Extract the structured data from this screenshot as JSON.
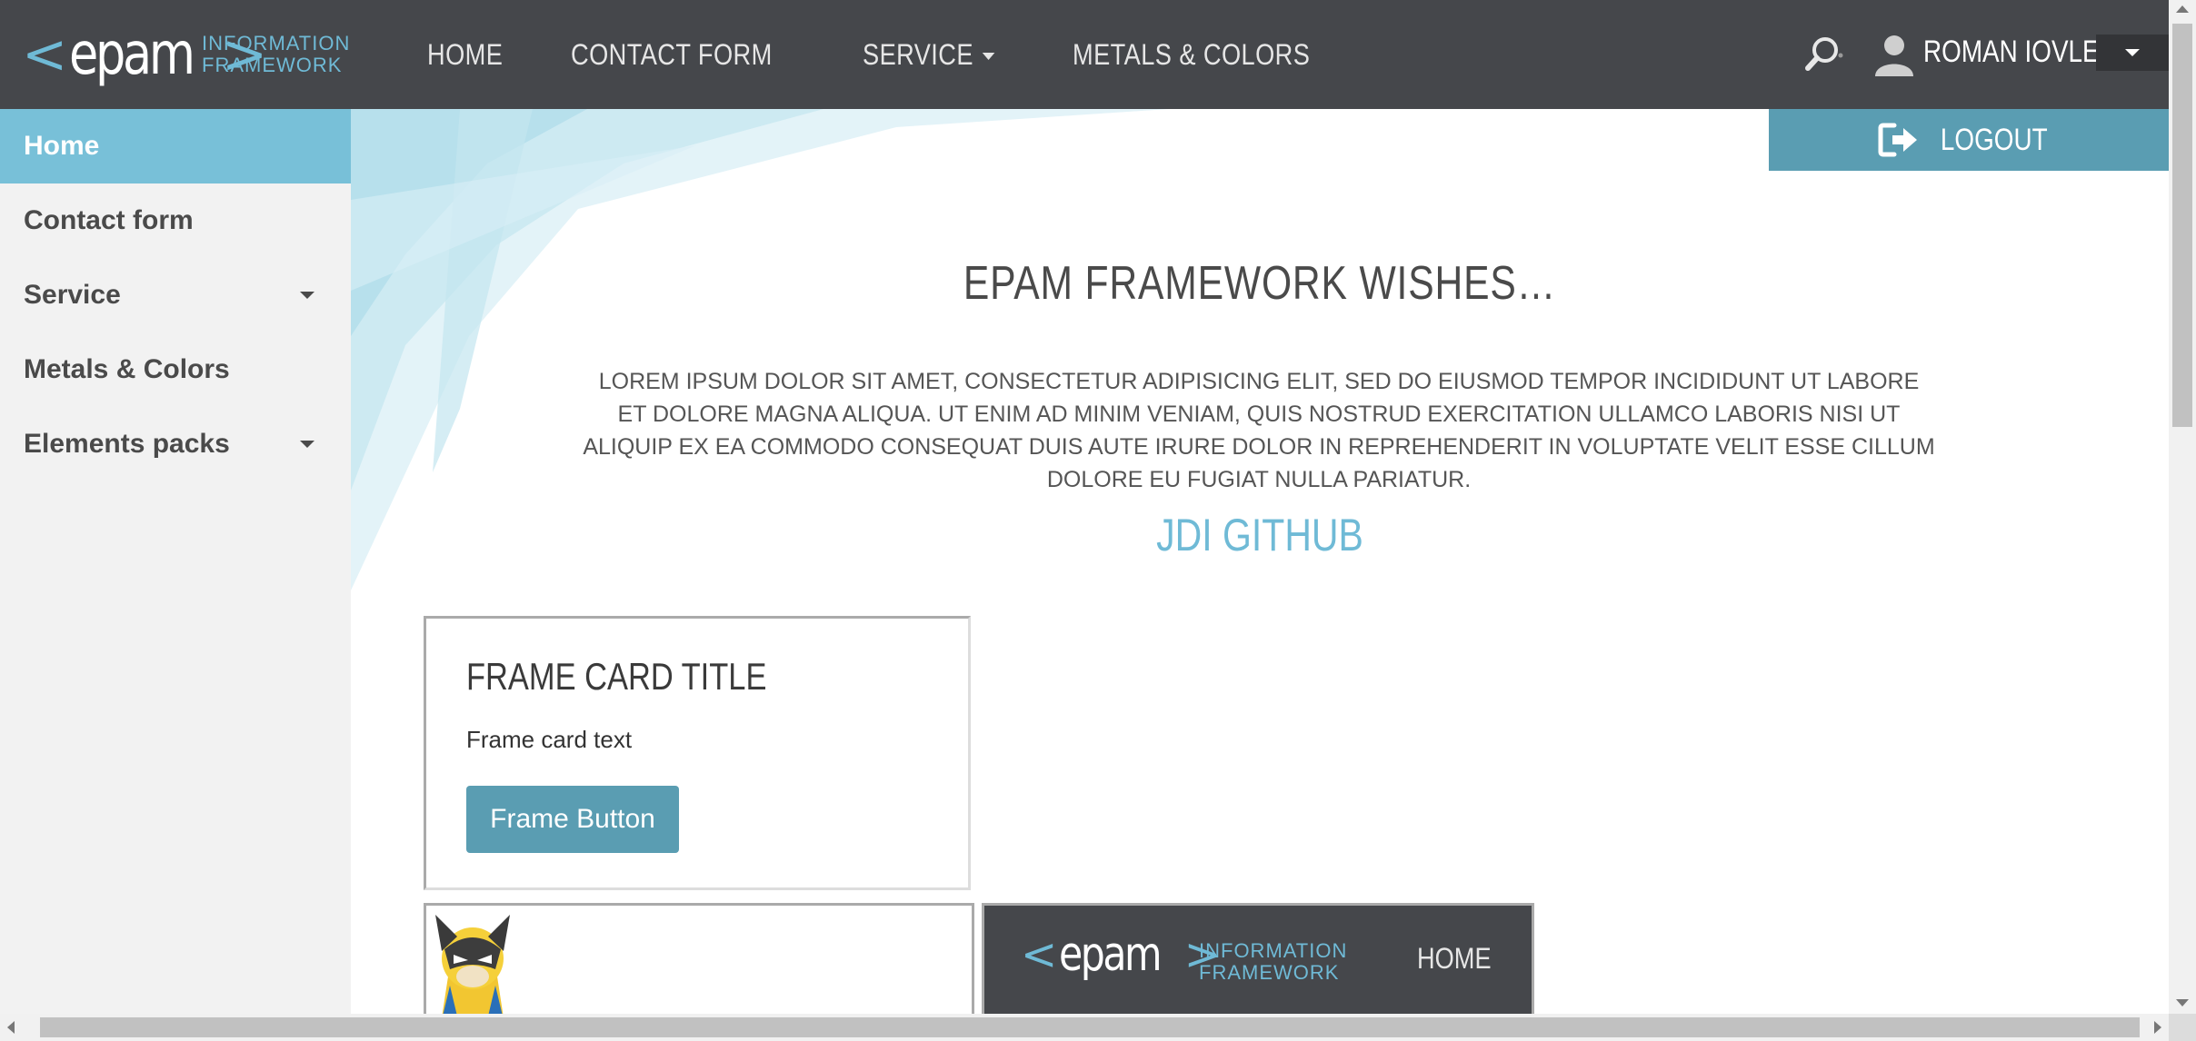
{
  "header": {
    "logo_word": "epam",
    "logo_chevron_left": "<",
    "logo_chevron_right": ">",
    "logo_sub_line1": "INFORMATION",
    "logo_sub_line2": "FRAMEWORK",
    "nav": [
      {
        "label": "HOME"
      },
      {
        "label": "CONTACT FORM"
      },
      {
        "label": "SERVICE"
      },
      {
        "label": "METALS & COLORS"
      }
    ],
    "search_icon": "search-icon",
    "user_icon": "user-icon",
    "user_name": "ROMAN IOVLEV"
  },
  "sidebar": {
    "items": [
      {
        "label": "Home",
        "active": true
      },
      {
        "label": "Contact form"
      },
      {
        "label": "Service",
        "has_submenu": true
      },
      {
        "label": "Metals & Colors"
      },
      {
        "label": "Elements packs",
        "has_submenu": true
      }
    ]
  },
  "main": {
    "logout_label": "LOGOUT",
    "title": "EPAM FRAMEWORK WISHES…",
    "text": "LOREM IPSUM DOLOR SIT AMET, CONSECTETUR ADIPISICING ELIT, SED DO EIUSMOD TEMPOR INCIDIDUNT UT LABORE ET DOLORE MAGNA ALIQUA. UT ENIM AD MINIM VENIAM, QUIS NOSTRUD EXERCITATION ULLAMCO LABORIS NISI UT ALIQUIP EX EA COMMODO CONSEQUAT DUIS AUTE IRURE DOLOR IN REPREHENDERIT IN VOLUPTATE VELIT ESSE CILLUM DOLORE EU FUGIAT NULLA PARIATUR.",
    "link": "JDI GITHUB",
    "frame_card": {
      "title": "FRAME CARD TITLE",
      "text": "Frame card text",
      "button": "Frame Button"
    },
    "inner_frame": {
      "logo_word": "epam",
      "logo_chevron_left": "<",
      "logo_chevron_right": ">",
      "logo_sub_line1": "INFORMATION",
      "logo_sub_line2": "FRAMEWORK",
      "nav_home": "HOME"
    }
  },
  "colors": {
    "header_bg": "#45474b",
    "accent": "#78c0d8",
    "button": "#5a9db2",
    "sidebar_bg": "#f2f2f2"
  }
}
